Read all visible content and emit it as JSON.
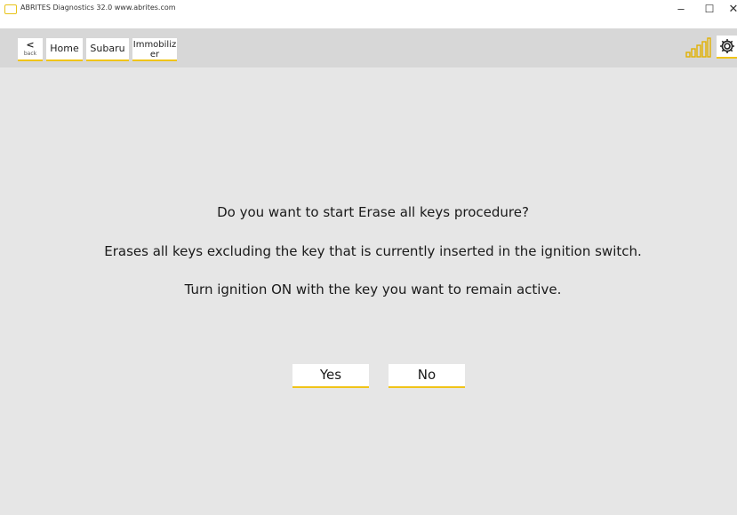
{
  "window": {
    "title": "ABRITES Diagnostics 32.0  www.abrites.com",
    "minimize_glyph": "–",
    "maximize_glyph": "☐",
    "close_glyph": "✕"
  },
  "nav": {
    "back_glyph": "<",
    "back_label": "back",
    "items": [
      {
        "label": "Home"
      },
      {
        "label": "Subaru"
      },
      {
        "label": "Immobiliz er"
      }
    ],
    "immo_line1": "Immobiliz",
    "immo_line2": "er"
  },
  "toolbar_icons": [
    "signal-strength-icon",
    "settings-gear-icon"
  ],
  "dialog": {
    "question": "Do you want to start Erase all keys procedure?",
    "description": "Erases all keys excluding the key that is currently inserted in the ignition switch.",
    "instruction": "Turn ignition ON with the key you want to remain active.",
    "yes_label": "Yes",
    "no_label": "No"
  },
  "colors": {
    "accent": "#f0c419",
    "background": "#e6e6e6",
    "navbar": "#d7d7d7"
  }
}
